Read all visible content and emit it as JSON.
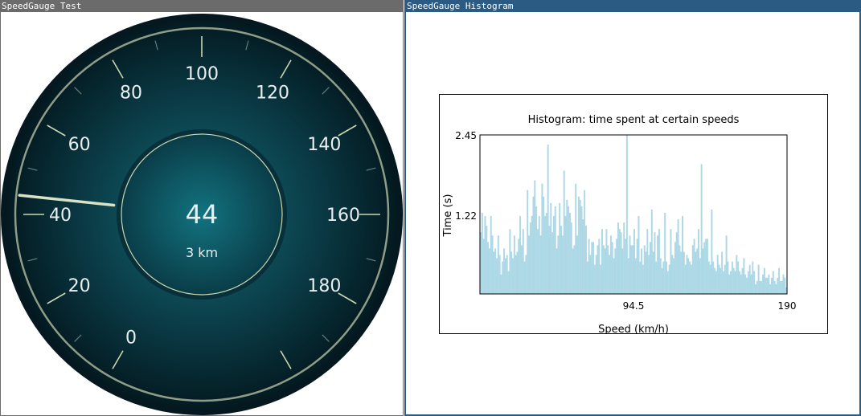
{
  "windows": {
    "gauge": {
      "title": "SpeedGauge Test"
    },
    "histogram": {
      "title": "SpeedGauge Histogram"
    }
  },
  "gauge": {
    "speed": "44",
    "distance": "3 km",
    "needle_value": 44,
    "scale_min": 0,
    "scale_max": 200,
    "major_labels": [
      "0",
      "20",
      "40",
      "60",
      "80",
      "100",
      "120",
      "140",
      "160",
      "180"
    ],
    "colors": {
      "face_center": "#0e5a66",
      "face_edge": "#051b22",
      "ring": "#c9d6b0",
      "needle": "#d8e2c4",
      "text": "#e9eef0"
    }
  },
  "chart_data": {
    "type": "bar",
    "title": "Histogram: time spent at certain speeds",
    "xlabel": "Speed (km/h)",
    "ylabel": "Time (s)",
    "xlim": [
      0,
      190
    ],
    "ylim": [
      0,
      2.45
    ],
    "xticks": [
      "94.5",
      "190"
    ],
    "yticks": [
      "1.22",
      "2.45"
    ],
    "bin_width": 1,
    "bar_color": "#add8e6",
    "values": [
      0.95,
      1.25,
      0.85,
      1.2,
      1.05,
      0.8,
      0.7,
      1.2,
      0.9,
      0.65,
      0.7,
      0.55,
      0.9,
      0.6,
      0.3,
      0.5,
      0.7,
      0.55,
      0.6,
      0.35,
      1.0,
      0.65,
      0.55,
      0.9,
      0.6,
      0.65,
      0.85,
      1.2,
      0.75,
      1.0,
      0.5,
      0.6,
      1.6,
      0.9,
      1.1,
      1.2,
      1.5,
      1.75,
      1.35,
      1.0,
      1.2,
      0.9,
      1.7,
      1.5,
      1.2,
      1.25,
      2.3,
      1.05,
      1.4,
      0.95,
      1.2,
      1.35,
      0.7,
      0.9,
      1.4,
      1.05,
      0.9,
      1.9,
      1.2,
      1.45,
      1.35,
      1.25,
      1.1,
      0.7,
      0.75,
      1.7,
      0.9,
      1.5,
      1.45,
      1.35,
      1.15,
      1.6,
      1.05,
      0.5,
      0.85,
      0.6,
      0.8,
      0.8,
      0.45,
      0.6,
      0.75,
      0.85,
      0.45,
      1.0,
      0.75,
      0.7,
      1.0,
      0.75,
      0.6,
      0.9,
      0.8,
      0.55,
      0.7,
      0.85,
      1.1,
      1.0,
      0.95,
      0.7,
      1.1,
      0.85,
      2.45,
      0.55,
      0.9,
      0.75,
      0.75,
      1.0,
      0.55,
      0.85,
      1.2,
      0.5,
      0.7,
      0.45,
      0.75,
      0.65,
      1.0,
      0.6,
      0.8,
      1.3,
      0.65,
      0.95,
      0.5,
      0.9,
      1.0,
      0.55,
      0.4,
      0.5,
      1.25,
      0.5,
      0.35,
      0.45,
      1.0,
      0.6,
      0.55,
      0.8,
      0.95,
      1.15,
      0.75,
      0.65,
      1.2,
      0.65,
      0.45,
      0.6,
      0.55,
      0.5,
      0.45,
      0.75,
      0.85,
      0.65,
      0.7,
      1.0,
      0.55,
      2.0,
      0.7,
      0.8,
      0.85,
      0.85,
      0.5,
      0.45,
      1.3,
      0.5,
      0.4,
      0.35,
      0.6,
      0.45,
      0.4,
      0.65,
      0.35,
      0.45,
      0.9,
      0.5,
      0.3,
      0.35,
      0.5,
      0.4,
      0.35,
      0.6,
      0.5,
      0.35,
      0.3,
      0.4,
      0.55,
      0.3,
      0.25,
      0.35,
      0.45,
      0.3,
      0.5,
      0.35,
      0.15,
      0.2,
      0.45,
      0.2,
      0.2,
      0.3,
      0.4,
      0.25,
      0.25,
      0.3,
      0.15,
      0.25,
      0.35,
      0.2,
      0.15,
      0.25,
      0.4,
      0.2,
      0.2,
      0.3,
      0.25,
      0.1
    ]
  }
}
